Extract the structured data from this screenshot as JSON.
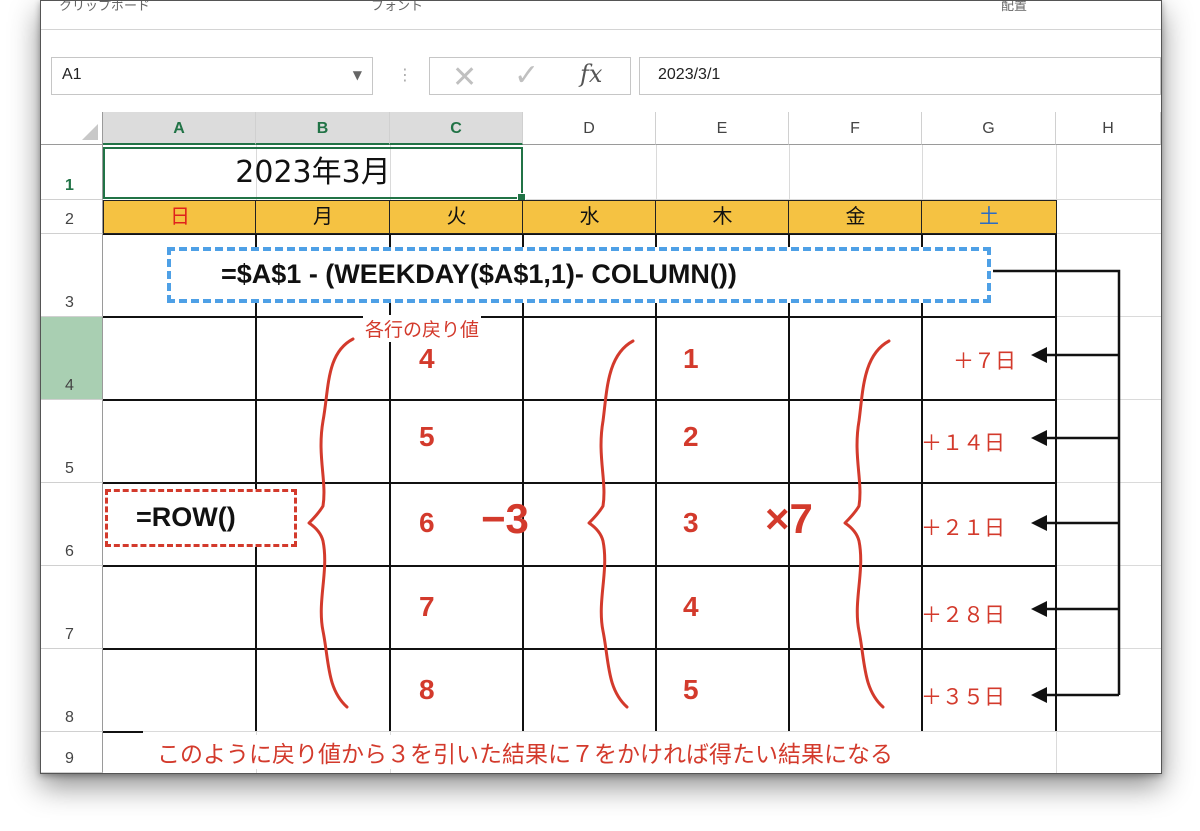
{
  "window": {
    "ribbon_labels": [
      "クリップボード",
      "フォント",
      "配置"
    ]
  },
  "formula_bar": {
    "name_box": "A1",
    "name_box_dropdown": "▼",
    "cancel_icon": "✕",
    "enter_icon": "✓",
    "fx_label": "fx",
    "formula_value": "2023/3/1"
  },
  "columns": [
    "A",
    "B",
    "C",
    "D",
    "E",
    "F",
    "G",
    "H"
  ],
  "rows": [
    "1",
    "2",
    "3",
    "4",
    "5",
    "6",
    "7",
    "8",
    "9"
  ],
  "cells": {
    "title": "2023年3月",
    "weekdays": [
      "日",
      "月",
      "火",
      "水",
      "木",
      "金",
      "土"
    ]
  },
  "colors": {
    "sunday": "#e0231c",
    "saturday": "#2b6cc4",
    "weekday": "#111111",
    "header_fill": "#f5c242",
    "annotation_red": "#d33a2c",
    "annotation_blue": "#4ea0e6",
    "selection_green": "#217346"
  },
  "annotations": {
    "main_formula": "=$A$1 - (WEEKDAY($A$1,1)- COLUMN())",
    "row_formula": "=ROW()",
    "brace_label": "各行の戻り値",
    "row_values": [
      "4",
      "5",
      "6",
      "7",
      "8"
    ],
    "minus_three": "−3",
    "result_values": [
      "1",
      "2",
      "3",
      "4",
      "5"
    ],
    "times_seven": "×7",
    "offsets": [
      "＋７日",
      "＋１４日",
      "＋２１日",
      "＋２８日",
      "＋３５日"
    ],
    "footer": "このように戻り値から３を引いた結果に７をかければ得たい結果になる"
  }
}
